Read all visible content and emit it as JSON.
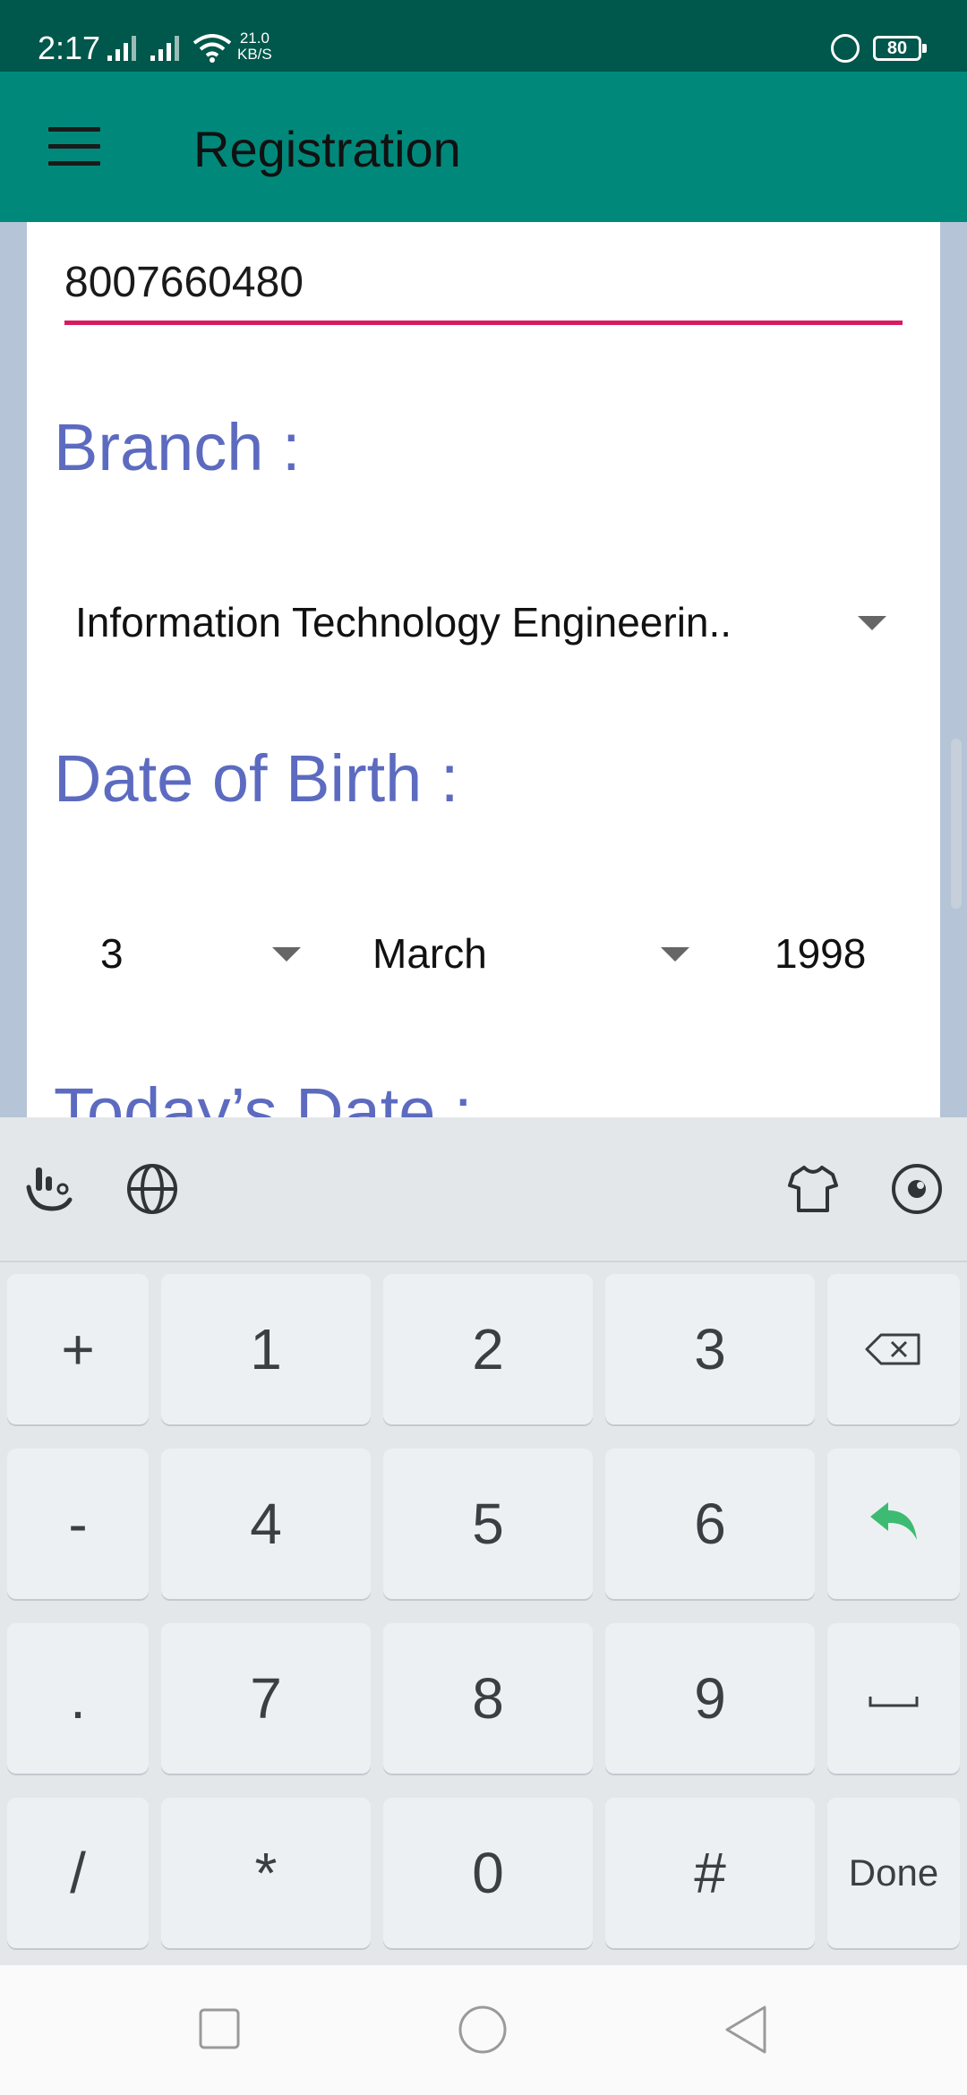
{
  "status_bar": {
    "time": "2:17",
    "net_speed_value": "21.0",
    "net_speed_unit": "KB/S",
    "battery": "80"
  },
  "app_bar": {
    "title": "Registration"
  },
  "form": {
    "phone_value": "8007660480",
    "branch_label": "Branch :",
    "branch_selected": "Information Technology Engineerin..",
    "dob_label": "Date of Birth :",
    "dob_day": "3",
    "dob_month": "March",
    "dob_year": "1998",
    "today_label": "Today’s Date :"
  },
  "keyboard": {
    "toolbar_icons": [
      "touchpal-logo-icon",
      "globe-icon",
      "theme-shirt-icon",
      "settings-icon"
    ],
    "rows": [
      [
        "+",
        "1",
        "2",
        "3",
        "backspace"
      ],
      [
        "-",
        "4",
        "5",
        "6",
        "enter"
      ],
      [
        ".",
        "7",
        "8",
        "9",
        "space"
      ],
      [
        "/",
        "*",
        "0",
        "#",
        "Done"
      ]
    ],
    "enter_color": "#3dbb73"
  },
  "colors": {
    "status_bar": "#00574b",
    "app_bar": "#00897b",
    "label": "#5c6bc0",
    "underline": "#d81b60"
  }
}
